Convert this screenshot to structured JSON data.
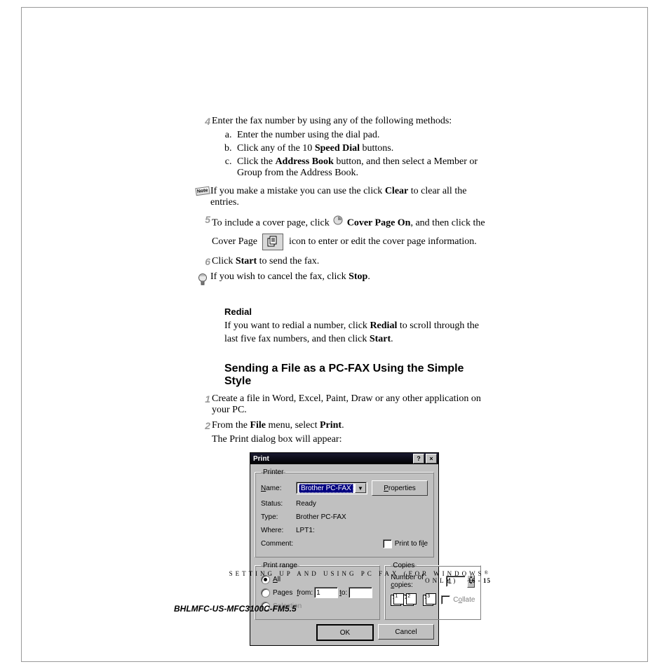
{
  "icons": {
    "note": "Note"
  },
  "steps": {
    "s4": {
      "num": "4",
      "text": "Enter the fax number by using any of the following methods:",
      "sub": {
        "a": "Enter the number using the dial pad.",
        "b_pre": "Click any of the 10 ",
        "b_bold": "Speed Dial",
        "b_post": " buttons.",
        "c_pre": "Click the ",
        "c_bold": "Address Book",
        "c_post": " button, and then select a Member or Group from the Address Book."
      }
    },
    "s5": {
      "num": "5",
      "pre": "To include a cover page, click ",
      "bold1": "Cover Page On",
      "mid": ", and then click the Cover Page ",
      "post": " icon to enter or edit the cover page information."
    },
    "s6": {
      "num": "6",
      "pre": "Click ",
      "bold": "Start",
      "post": " to send the fax."
    }
  },
  "note_clear": {
    "pre": "If you make a mistake you can use the click ",
    "bold": "Clear",
    "post": " to clear all the entries."
  },
  "tip_stop": {
    "pre": "If you wish to cancel the fax, click ",
    "bold": "Stop",
    "post": "."
  },
  "redial": {
    "heading": "Redial",
    "p_pre": "If you want to redial a number, click ",
    "p_bold1": "Redial",
    "p_mid": " to scroll through the last five fax numbers, and then click ",
    "p_bold2": "Start",
    "p_post": "."
  },
  "section": {
    "heading": "Sending a File as a PC-FAX Using the Simple Style",
    "s1": {
      "num": "1",
      "text": "Create a file in Word, Excel, Paint, Draw or any other application on your PC."
    },
    "s2": {
      "num": "2",
      "pre": "From the ",
      "bold1": "File",
      "mid": " menu, select ",
      "bold2": "Print",
      "post": ".",
      "after": "The Print dialog box will appear:"
    }
  },
  "dialog": {
    "title": "Print",
    "printer": {
      "legend": "Printer",
      "name_u": "N",
      "name_rest": "ame:",
      "name_value": "Brother PC-FAX",
      "properties_u": "P",
      "properties_rest": "roperties",
      "status_label": "Status:",
      "status_value": "Ready",
      "type_label": "Type:",
      "type_value": "Brother PC-FAX",
      "where_label": "Where:",
      "where_value": "LPT1:",
      "comment_label": "Comment:",
      "ptf_pre": "Print to fi",
      "ptf_u": "l",
      "ptf_post": "e"
    },
    "range": {
      "legend": "Print range",
      "all_u": "A",
      "all_rest": "ll",
      "pages_pre": "Pa",
      "pages_u": "g",
      "pages_post": "es",
      "from_u": "f",
      "from_rest": "rom:",
      "from_value": "1",
      "to_u": "t",
      "to_rest": "o:",
      "sel_u": "S",
      "sel_rest": "election"
    },
    "copies": {
      "legend": "Copies",
      "num_pre": "Number of ",
      "num_u": "c",
      "num_post": "opies:",
      "value": "1",
      "collate_pre": "C",
      "collate_u": "o",
      "collate_post": "llate"
    },
    "buttons": {
      "ok": "OK",
      "cancel": "Cancel"
    }
  },
  "footer": {
    "text_pre": "SETTING UP AND USING PC FAX (FOR WINDOWS",
    "reg": "®",
    "text_post": " ONLY)",
    "page": "16 - 15"
  },
  "doc_id": "BHLMFC-US-MFC3100C-FM5.5"
}
